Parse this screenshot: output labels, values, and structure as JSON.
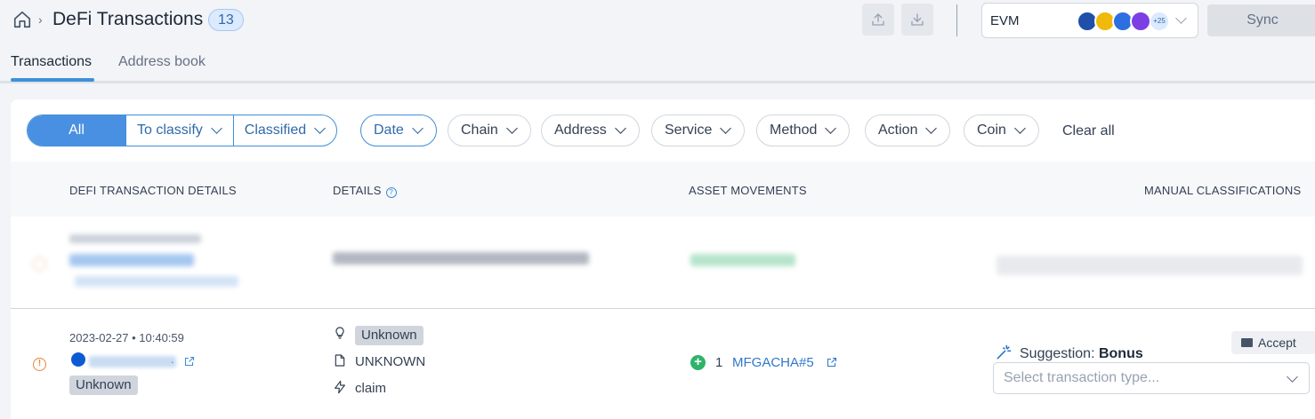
{
  "header": {
    "breadcrumb_sep": "›",
    "title": "DeFi Transactions",
    "count": "13",
    "chain_select": {
      "label": "EVM",
      "more_count": "+25"
    },
    "sync_label": "Sync"
  },
  "tabs": [
    {
      "label": "Transactions",
      "active": true
    },
    {
      "label": "Address book",
      "active": false
    }
  ],
  "filters": {
    "status_segments": [
      "All",
      "To classify",
      "Classified"
    ],
    "pills": [
      "Date",
      "Chain",
      "Address",
      "Service",
      "Method",
      "Action",
      "Coin"
    ],
    "clear_all": "Clear all"
  },
  "table": {
    "columns": [
      "DEFI TRANSACTION DETAILS",
      "DETAILS",
      "ASSET MOVEMENTS",
      "MANUAL CLASSIFICATIONS"
    ],
    "rows": [
      {
        "date": "2023-02-27 • 10:40:59",
        "address_suffix": ".",
        "status_tag": "Unknown",
        "details": {
          "label_tag": "Unknown",
          "method": "UNKNOWN",
          "action": "claim"
        },
        "asset": {
          "amount": "1",
          "symbol": "MFGACHA#5"
        },
        "suggestion": {
          "prefix": "Suggestion:",
          "value": "Bonus"
        },
        "accept_label": "Accept",
        "select_placeholder": "Select transaction type..."
      }
    ]
  },
  "colors": {
    "accent": "#4a90e2",
    "warning": "#e8833a",
    "success": "#2fb36b"
  },
  "icons": [
    "home-icon",
    "upload-icon",
    "download-icon",
    "ethereum-icon",
    "external-link-icon",
    "lightbulb-icon",
    "document-icon",
    "lightning-icon",
    "magic-wand-icon",
    "mail-icon",
    "help-icon",
    "warning-icon",
    "plus-circle-icon"
  ]
}
